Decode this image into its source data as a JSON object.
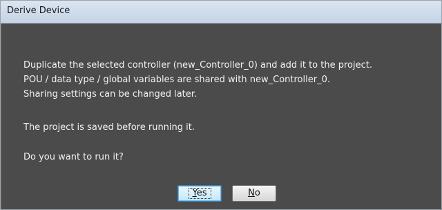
{
  "dialog": {
    "title": "Derive Device",
    "message_lines": [
      "Duplicate the selected controller (new_Controller_0) and add it to the project.",
      "POU / data type / global variables are shared with new_Controller_0.",
      "Sharing settings can be changed later.",
      "The project is saved before running it.",
      "Do you want to run it?"
    ],
    "buttons": {
      "yes": {
        "mnemonic": "Y",
        "rest": "es"
      },
      "no": {
        "mnemonic": "N",
        "rest": "o"
      }
    }
  }
}
